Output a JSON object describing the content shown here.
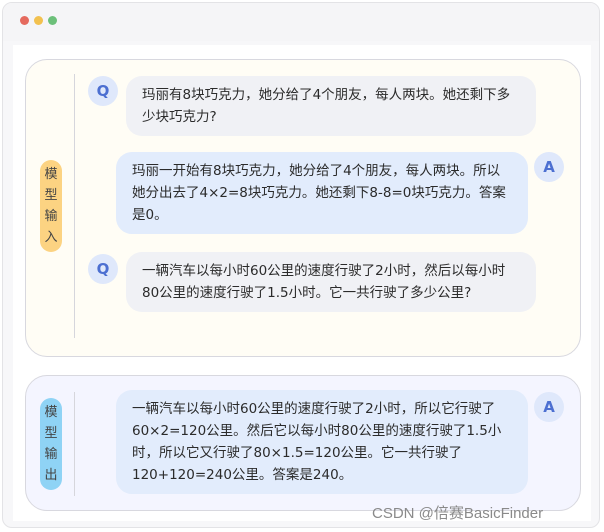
{
  "window": {
    "traffic_lights": [
      "#e56a5e",
      "#f2c14f",
      "#6cc07a"
    ]
  },
  "input_panel": {
    "label": [
      "模",
      "型",
      "输",
      "入"
    ],
    "messages": [
      {
        "role": "Q",
        "text": "玛丽有8块巧克力，她分给了4个朋友，每人两块。她还剩下多少块巧克力?"
      },
      {
        "role": "A",
        "text": "玛丽一开始有8块巧克力，她分给了4个朋友，每人两块。所以她分出去了4×2=8块巧克力。她还剩下8-8=0块巧克力。答案是0。"
      },
      {
        "role": "Q",
        "text": "一辆汽车以每小时60公里的速度行驶了2小时，然后以每小时80公里的速度行驶了1.5小时。它一共行驶了多少公里?"
      }
    ]
  },
  "output_panel": {
    "label": [
      "模",
      "型",
      "输",
      "出"
    ],
    "messages": [
      {
        "role": "A",
        "text": "一辆汽车以每小时60公里的速度行驶了2小时，所以它行驶了60×2=120公里。然后它以每小时80公里的速度行驶了1.5小时，所以它又行驶了80×1.5=120公里。它一共行驶了120+120=240公里。答案是240。"
      }
    ]
  },
  "watermark": "CSDN @倍赛BasicFinder"
}
